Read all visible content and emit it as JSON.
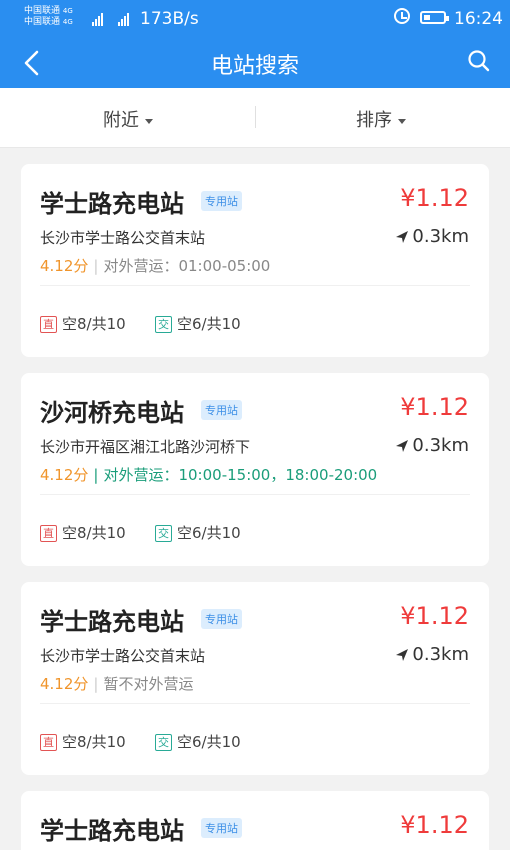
{
  "status_bar": {
    "carrier1": "中国联通",
    "carrier2": "中国联通",
    "net1": "4G",
    "net2": "4G",
    "speed": "173B/s",
    "time": "16:24"
  },
  "nav": {
    "title": "电站搜索",
    "back_icon": "back-arrow-icon",
    "search_icon": "search-icon"
  },
  "filters": {
    "nearby": "附近",
    "sort": "排序"
  },
  "colors": {
    "brand": "#2a8ef0",
    "price": "#ef3b3b",
    "score": "#f0952c",
    "tag": "#3c8fe6",
    "open_green": "#1a9d7a",
    "dc": "#e25454",
    "ac": "#28aa96"
  },
  "stations": [
    {
      "name": "学士路充电站",
      "tag": "专用站",
      "price": "¥1.12",
      "address": "长沙市学士路公交首末站",
      "distance": "0.3km",
      "score": "4.12分",
      "separator": "|",
      "open": "对外营运：01:00-05:00",
      "dc_label": "直",
      "dc_value": "空8/共10",
      "ac_label": "交",
      "ac_value": "空6/共10"
    },
    {
      "name": "沙河桥充电站",
      "tag": "专用站",
      "price": "¥1.12",
      "address": "长沙市开福区湘江北路沙河桥下",
      "distance": "0.3km",
      "score": "4.12分",
      "separator": "|",
      "open": "对外营运：10:00-15:00，18:00-20:00",
      "dc_label": "直",
      "dc_value": "空8/共10",
      "ac_label": "交",
      "ac_value": "空6/共10"
    },
    {
      "name": "学士路充电站",
      "tag": "专用站",
      "price": "¥1.12",
      "address": "长沙市学士路公交首末站",
      "distance": "0.3km",
      "score": "4.12分",
      "separator": "|",
      "open": "暂不对外营运",
      "dc_label": "直",
      "dc_value": "空8/共10",
      "ac_label": "交",
      "ac_value": "空6/共10"
    },
    {
      "name": "学士路充电站",
      "tag": "专用站",
      "price": "¥1.12"
    }
  ]
}
